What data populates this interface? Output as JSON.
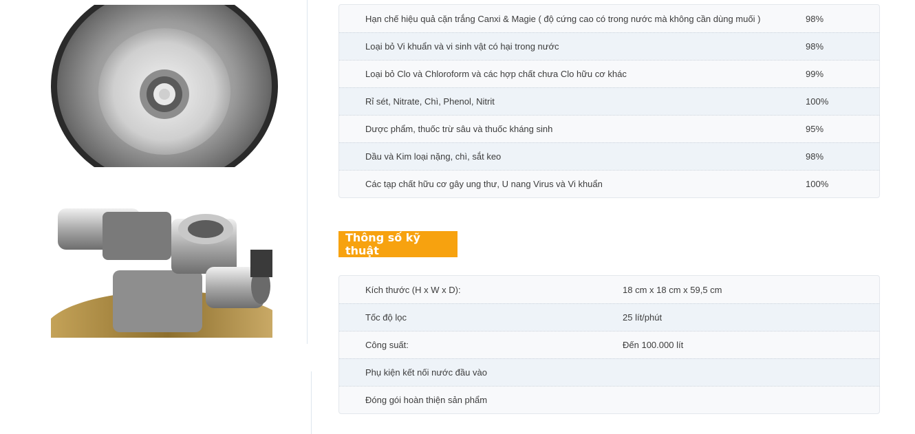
{
  "images": {
    "top": {
      "name": "product-photo-bowl-top-view"
    },
    "bottom": {
      "name": "product-photo-valve-fitting"
    }
  },
  "effectiveness_table": {
    "rows": [
      {
        "label": "Hạn chế hiệu quả cặn trắng Canxi & Magie ( độ cứng cao có trong nước mà không cần dùng muối )",
        "value": "98%"
      },
      {
        "label": "Loại bỏ Vi khuẩn và vi sinh vật có hại trong nước",
        "value": "98%"
      },
      {
        "label": "Loại bỏ Clo và Chloroform và các hợp chất chưa Clo hữu cơ khác",
        "value": "99%"
      },
      {
        "label": "Rỉ sét, Nitrate, Chì, Phenol, Nitrit",
        "value": "100%"
      },
      {
        "label": "Dược phẩm, thuốc trừ sâu và thuốc kháng sinh",
        "value": "95%"
      },
      {
        "label": "Dầu và Kim loại nặng, chì, sắt keo",
        "value": "98%"
      },
      {
        "label": "Các tạp chất hữu cơ gây ung thư, U nang Virus và  Vi khuẩn",
        "value": "100%"
      }
    ]
  },
  "spec_section": {
    "heading": "Thông số kỹ thuật"
  },
  "spec_table": {
    "rows": [
      {
        "label": "Kích thước (H x W x D):",
        "value": "18 cm x  18 cm  x 59,5 cm"
      },
      {
        "label": "Tốc độ lọc",
        "value": "25 lít/phút"
      },
      {
        "label": "Công suất:",
        "value": "Đến 100.000 lít"
      },
      {
        "label": "Phụ kiện kết nối nước đầu vào",
        "value": ""
      },
      {
        "label": "Đóng gói hoàn thiện sản phẩm",
        "value": ""
      }
    ]
  },
  "colors": {
    "heading_bg": "#f7a20f",
    "row_alt_bg": "#eef3f8",
    "table_border": "#e3e7ec"
  }
}
